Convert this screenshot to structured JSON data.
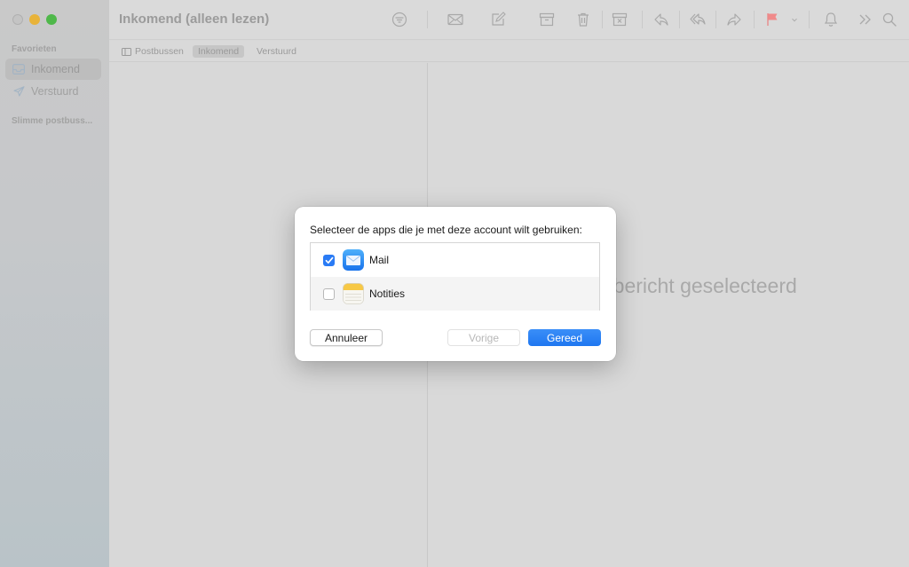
{
  "window": {
    "title": "Inkomend (alleen lezen)"
  },
  "sidebar": {
    "favorites_heading": "Favorieten",
    "items": [
      {
        "label": "Inkomend",
        "icon": "inbox-icon",
        "active": true
      },
      {
        "label": "Verstuurd",
        "icon": "paper-plane-icon",
        "active": false
      }
    ],
    "smart_mailboxes_heading": "Slimme postbuss..."
  },
  "favorites_bar": {
    "items": [
      {
        "label": "Postbussen",
        "icon": "sidebar-icon"
      },
      {
        "label": "Inkomend",
        "active": true
      },
      {
        "label": "Verstuurd"
      }
    ]
  },
  "toolbar": {
    "icons": [
      "filter-icon",
      "envelope-icon",
      "compose-icon",
      "archive-icon",
      "trash-icon",
      "junk-icon",
      "reply-icon",
      "reply-all-icon",
      "forward-icon",
      "flag-icon",
      "chevron-down-icon",
      "bell-icon",
      "overflow-icon",
      "search-icon"
    ]
  },
  "message_pane": {
    "empty_text": "Geen bericht geselecteerd"
  },
  "dialog": {
    "prompt": "Selecteer de apps die je met deze account wilt gebruiken:",
    "apps": [
      {
        "name": "Mail",
        "checked": true,
        "icon": "mail-app-icon"
      },
      {
        "name": "Notities",
        "checked": false,
        "icon": "notes-app-icon"
      }
    ],
    "buttons": {
      "cancel": "Annuleer",
      "previous": "Vorige",
      "done": "Gereed"
    }
  },
  "colors": {
    "accent": "#1f77f0",
    "flag": "#f08a8a"
  }
}
